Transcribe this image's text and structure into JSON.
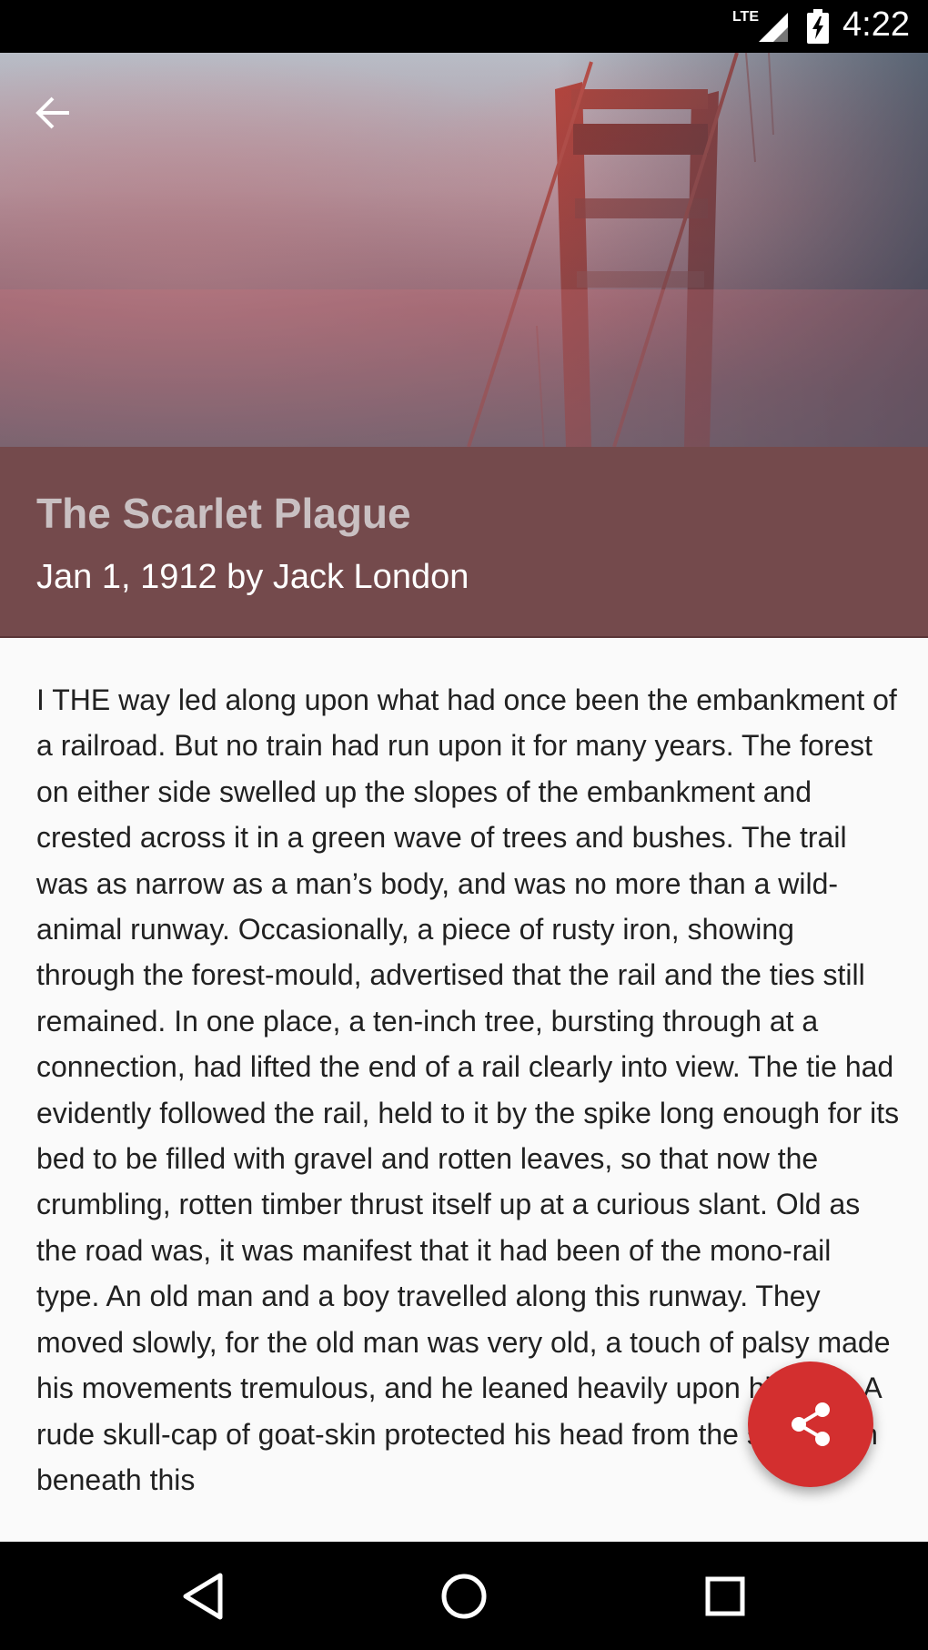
{
  "status_bar": {
    "network": "LTE",
    "time": "4:22",
    "icons": [
      "lte-signal-icon",
      "battery-charging-icon"
    ]
  },
  "toolbar": {
    "back_icon": "arrow-back-icon"
  },
  "story": {
    "title": "The Scarlet Plague",
    "subtitle": "Jan 1, 1912 by Jack London",
    "body": "I THE way led along upon what had once been the embankment of a railroad. But no train had run upon it for many years. The forest on either side swelled up the slopes of the embankment and crested across it in a green wave of trees and bushes. The trail was as narrow as a man’s body, and was no more than a wild-animal runway. Occasionally, a piece of rusty iron, showing through the forest-mould, advertised that the rail and the ties still remained. In one place, a ten-inch tree, bursting through at a connection, had lifted the end of a rail clearly into view. The tie had evidently followed the rail, held to it by the spike long enough for its bed to be filled with gravel and rotten leaves, so that now the crumbling, rotten timber thrust itself up at a curious slant. Old as the road was, it was manifest that it had been of the mono-rail type. An old man and a boy travelled along this runway. They moved slowly, for the old man was very old, a touch of palsy made his movements tremulous, and he leaned heavily upon his staff. A rude skull-cap of goat-skin protected his head from the sun. From beneath this"
  },
  "fab": {
    "icon": "share-icon"
  },
  "nav_bar": {
    "icons": [
      "back-triangle-icon",
      "home-circle-icon",
      "recents-square-icon"
    ]
  },
  "colors": {
    "title_panel": "#744a4c",
    "fab": "#d32f2f",
    "title_text": "#c9c0c2",
    "body_text": "#212121"
  }
}
